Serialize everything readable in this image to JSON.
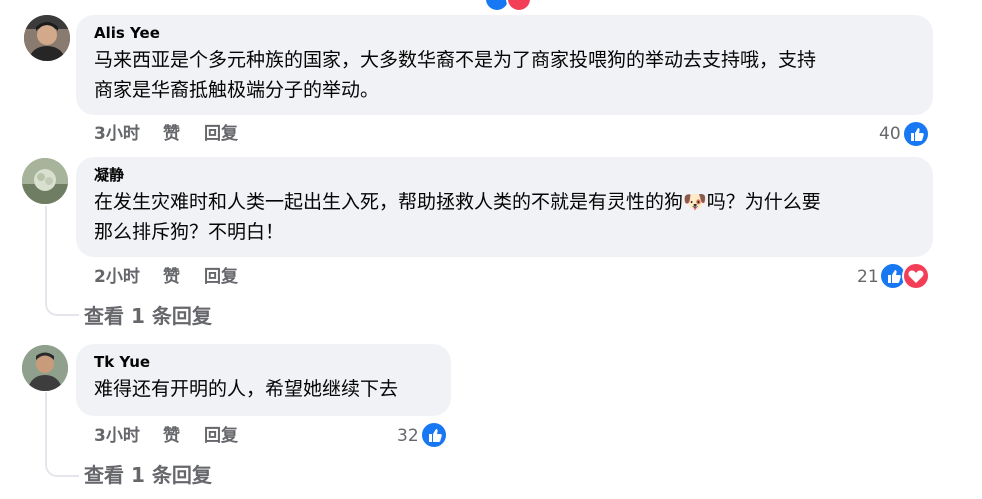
{
  "comments": [
    {
      "name": "Alis Yee",
      "text_line1": "马来西亚是个多元种族的国家，大多数华裔不是为了商家投喂狗的举动去支持哦，支持",
      "text_line2": "商家是华裔抵触极端分子的举动。",
      "time": "3小时",
      "like_label": "赞",
      "reply_label": "回复",
      "reaction_count": "40",
      "reactions": [
        "like"
      ]
    },
    {
      "name": "凝静",
      "text_line1": "在发生灾难时和人类一起出生入死，帮助拯救人类的不就是有灵性的狗",
      "emoji": "🐶",
      "text_line1_after": "吗？为什么要",
      "text_line2": "那么排斥狗？不明白！",
      "time": "2小时",
      "like_label": "赞",
      "reply_label": "回复",
      "reaction_count": "21",
      "reactions": [
        "like",
        "love"
      ],
      "view_replies": "查看 1 条回复"
    },
    {
      "name": "Tk Yue",
      "text_line1": "难得还有开明的人，希望她继续下去",
      "time": "3小时",
      "like_label": "赞",
      "reply_label": "回复",
      "reaction_count": "32",
      "reactions": [
        "like"
      ],
      "view_replies": "查看 1 条回复"
    }
  ],
  "colors": {
    "bubble": "#f0f2f5",
    "meta_text": "#65676b",
    "like": "#1877f2",
    "love": "#f33e58"
  }
}
